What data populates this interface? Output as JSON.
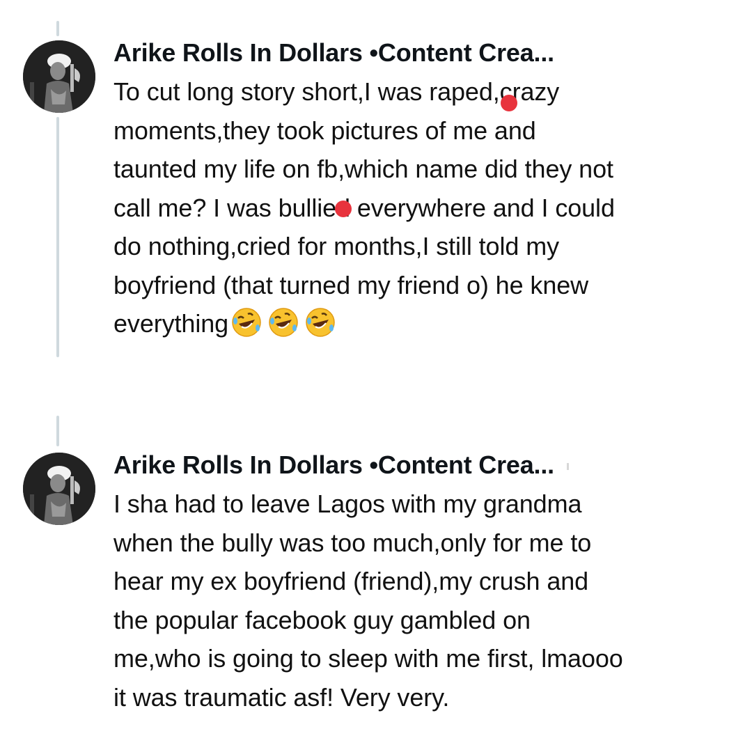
{
  "tweets": [
    {
      "author": "Arike Rolls In Dollars •Content Crea...",
      "avatar": "profile-photo",
      "text": "To cut long story short,I was raped,crazy\nmoments,they took pictures of me and\ntaunted my life on fb,which name did they not\ncall me? I was bullied everywhere and I could\ndo nothing,cried for months,I still told my\nboyfriend (that turned my friend o) he knew\neverything",
      "emoji": [
        "rolling-on-floor-laughing",
        "rolling-on-floor-laughing",
        "rolling-on-floor-laughing"
      ]
    },
    {
      "author": "Arike Rolls In Dollars •Content Crea...",
      "avatar": "profile-photo",
      "text": "I sha had to leave Lagos with my grandma\nwhen the bully was too much,only for me to\nhear my ex boyfriend (friend),my crush and\nthe popular facebook guy gambled on\nme,who is going to sleep with me first, lmaooo\nit was traumatic asf! Very very."
    }
  ],
  "colors": {
    "thread_line": "#cfd9de",
    "redaction_dot": "#e8333d",
    "text": "#0f1419"
  }
}
